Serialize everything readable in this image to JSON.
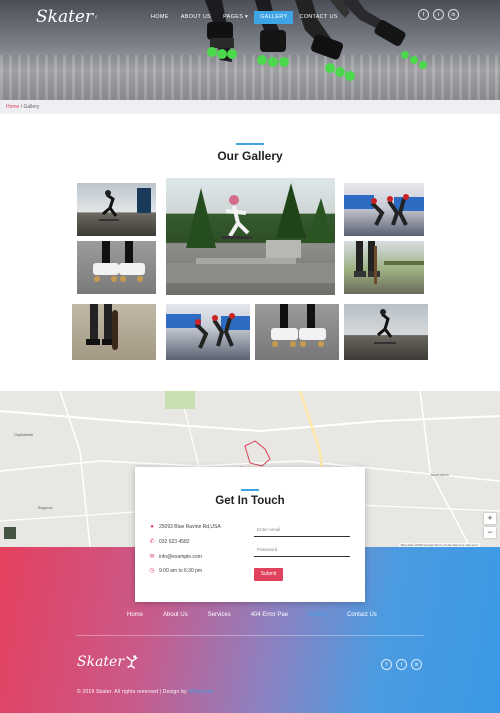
{
  "brand": {
    "logo_text": "Skater"
  },
  "nav": {
    "items": [
      "Home",
      "About Us",
      "Pages ▾",
      "Gallery",
      "Contact Us"
    ],
    "active_index": 3
  },
  "social": [
    "f",
    "t",
    "in"
  ],
  "breadcrumb": {
    "home": "Home",
    "separator": " / ",
    "current": "Gallery"
  },
  "gallery": {
    "title": "Our Gallery"
  },
  "map": {
    "zoom_in": "+",
    "zoom_out": "−",
    "footer_text": "Map data ©2019 Google  Terms of Use  Report a map error"
  },
  "contact": {
    "title": "Get In Touch",
    "address": "25093 Blue Ravine Rd,USA",
    "phone": "032 623 4582",
    "email": "info@example.com",
    "hours": "9:00 am to 6:30 pm",
    "email_placeholder": "Enter email",
    "password_placeholder": "Password",
    "submit_label": "Submit"
  },
  "footer": {
    "nav": [
      "Home",
      "About Us",
      "Services",
      "404 Error Pae",
      "Gallery",
      "Contact Us"
    ],
    "active_index": 4,
    "logo_text": "Skater",
    "copyright": "© 2019 Skater. All rights reserved | Design by ",
    "designer": "W3layouts"
  },
  "colors": {
    "accent_blue": "#3da4e6",
    "accent_red": "#e0415c"
  }
}
